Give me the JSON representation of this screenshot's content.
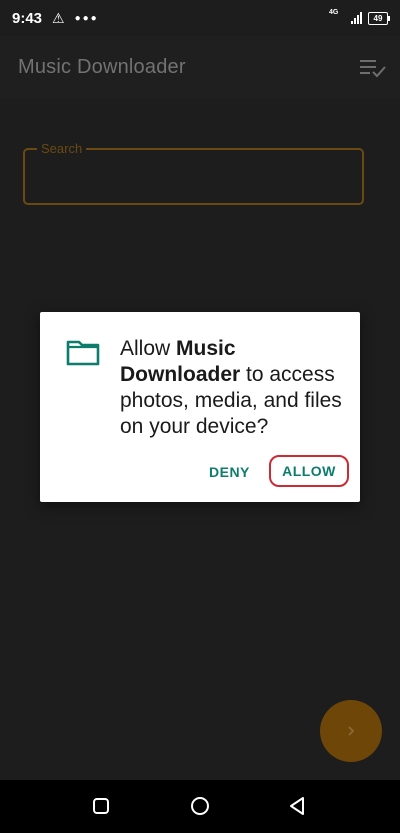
{
  "status_bar": {
    "time": "9:43",
    "network_type": "4G",
    "battery_level": "49"
  },
  "toolbar": {
    "title": "Music Downloader"
  },
  "search": {
    "label": "Search",
    "value": ""
  },
  "dialog": {
    "message_prefix": "Allow ",
    "app_name": "Music Downloader",
    "message_suffix": " to access photos, media, and files on your device?",
    "deny_label": "DENY",
    "allow_label": "ALLOW"
  },
  "colors": {
    "accent": "#6e4608",
    "dialog_button": "#0e7c6c",
    "highlight": "#cc2a35"
  }
}
